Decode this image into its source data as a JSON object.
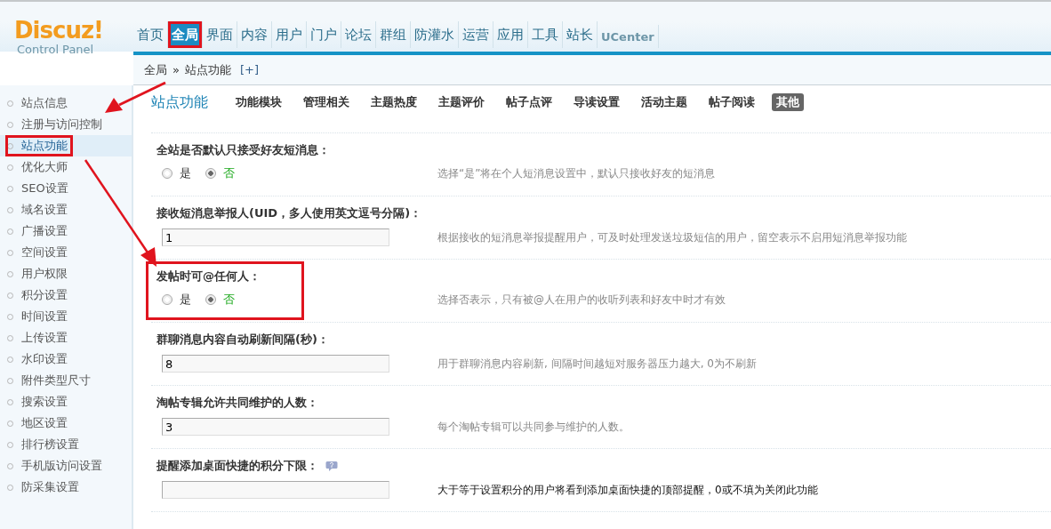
{
  "logo": {
    "name": "Discuz",
    "mark": "!",
    "subtitle": "Control Panel"
  },
  "nav": [
    {
      "label": "首页",
      "selected": false,
      "highlighted": false
    },
    {
      "label": "全局",
      "selected": true,
      "highlighted": true
    },
    {
      "label": "界面",
      "selected": false,
      "highlighted": false
    },
    {
      "label": "内容",
      "selected": false,
      "highlighted": false
    },
    {
      "label": "用户",
      "selected": false,
      "highlighted": false
    },
    {
      "label": "门户",
      "selected": false,
      "highlighted": false
    },
    {
      "label": "论坛",
      "selected": false,
      "highlighted": false
    },
    {
      "label": "群组",
      "selected": false,
      "highlighted": false
    },
    {
      "label": "防灌水",
      "selected": false,
      "highlighted": false
    },
    {
      "label": "运营",
      "selected": false,
      "highlighted": false
    },
    {
      "label": "应用",
      "selected": false,
      "highlighted": false
    },
    {
      "label": "工具",
      "selected": false,
      "highlighted": false
    },
    {
      "label": "站长",
      "selected": false,
      "highlighted": false
    },
    {
      "label": "UCenter",
      "selected": false,
      "highlighted": false
    }
  ],
  "breadcrumb": {
    "items": [
      "全局",
      "站点功能"
    ],
    "separator": "»",
    "add": "[+]"
  },
  "sidebar": [
    {
      "label": "站点信息",
      "selected": false,
      "highlighted": false
    },
    {
      "label": "注册与访问控制",
      "selected": false,
      "highlighted": false
    },
    {
      "label": "站点功能",
      "selected": true,
      "highlighted": true
    },
    {
      "label": "优化大师",
      "selected": false,
      "highlighted": false
    },
    {
      "label": "SEO设置",
      "selected": false,
      "highlighted": false
    },
    {
      "label": "域名设置",
      "selected": false,
      "highlighted": false
    },
    {
      "label": "广播设置",
      "selected": false,
      "highlighted": false
    },
    {
      "label": "空间设置",
      "selected": false,
      "highlighted": false
    },
    {
      "label": "用户权限",
      "selected": false,
      "highlighted": false
    },
    {
      "label": "积分设置",
      "selected": false,
      "highlighted": false
    },
    {
      "label": "时间设置",
      "selected": false,
      "highlighted": false
    },
    {
      "label": "上传设置",
      "selected": false,
      "highlighted": false
    },
    {
      "label": "水印设置",
      "selected": false,
      "highlighted": false
    },
    {
      "label": "附件类型尺寸",
      "selected": false,
      "highlighted": false
    },
    {
      "label": "搜索设置",
      "selected": false,
      "highlighted": false
    },
    {
      "label": "地区设置",
      "selected": false,
      "highlighted": false
    },
    {
      "label": "排行榜设置",
      "selected": false,
      "highlighted": false
    },
    {
      "label": "手机版访问设置",
      "selected": false,
      "highlighted": false
    },
    {
      "label": "防采集设置",
      "selected": false,
      "highlighted": false
    }
  ],
  "section": {
    "title": "站点功能",
    "tabs": [
      {
        "label": "功能模块",
        "selected": false
      },
      {
        "label": "管理相关",
        "selected": false
      },
      {
        "label": "主题热度",
        "selected": false
      },
      {
        "label": "主题评价",
        "selected": false
      },
      {
        "label": "帖子点评",
        "selected": false
      },
      {
        "label": "导读设置",
        "selected": false
      },
      {
        "label": "活动主题",
        "selected": false
      },
      {
        "label": "帖子阅读",
        "selected": false
      },
      {
        "label": "其他",
        "selected": true
      }
    ]
  },
  "settings": [
    {
      "kind": "radio",
      "label": "全站是否默认只接受好友短消息：",
      "options": [
        {
          "label": "是",
          "selected": false
        },
        {
          "label": "否",
          "selected": true
        }
      ],
      "hint": "选择“是”将在个人短消息设置中，默认只接收好友的短消息",
      "highlighted": false
    },
    {
      "kind": "text",
      "label": "接收短消息举报人(UID，多人使用英文逗号分隔)：",
      "value": "1",
      "hint": "根据接收的短消息举报提醒用户，可及时处理发送垃圾短信的用户，留空表示不启用短消息举报功能",
      "highlighted": false
    },
    {
      "kind": "radio",
      "label": "发帖时可@任何人：",
      "options": [
        {
          "label": "是",
          "selected": false
        },
        {
          "label": "否",
          "selected": true
        }
      ],
      "hint": "选择否表示，只有被@人在用户的收听列表和好友中时才有效",
      "highlighted": true
    },
    {
      "kind": "text",
      "label": "群聊消息内容自动刷新间隔(秒)：",
      "value": "8",
      "hint": "用于群聊消息内容刷新, 间隔时间越短对服务器压力越大, 0为不刷新",
      "highlighted": false
    },
    {
      "kind": "text",
      "label": "淘帖专辑允许共同维护的人数：",
      "value": "3",
      "hint": "每个淘帖专辑可以共同参与维护的人数。",
      "highlighted": false
    },
    {
      "kind": "text",
      "label": "提醒添加桌面快捷的积分下限：",
      "help": true,
      "hint": "大于等于设置积分的用户将看到添加桌面快捷的顶部提醒，0或不填为关闭此功能",
      "hint_strong": true,
      "highlighted": false
    }
  ]
}
